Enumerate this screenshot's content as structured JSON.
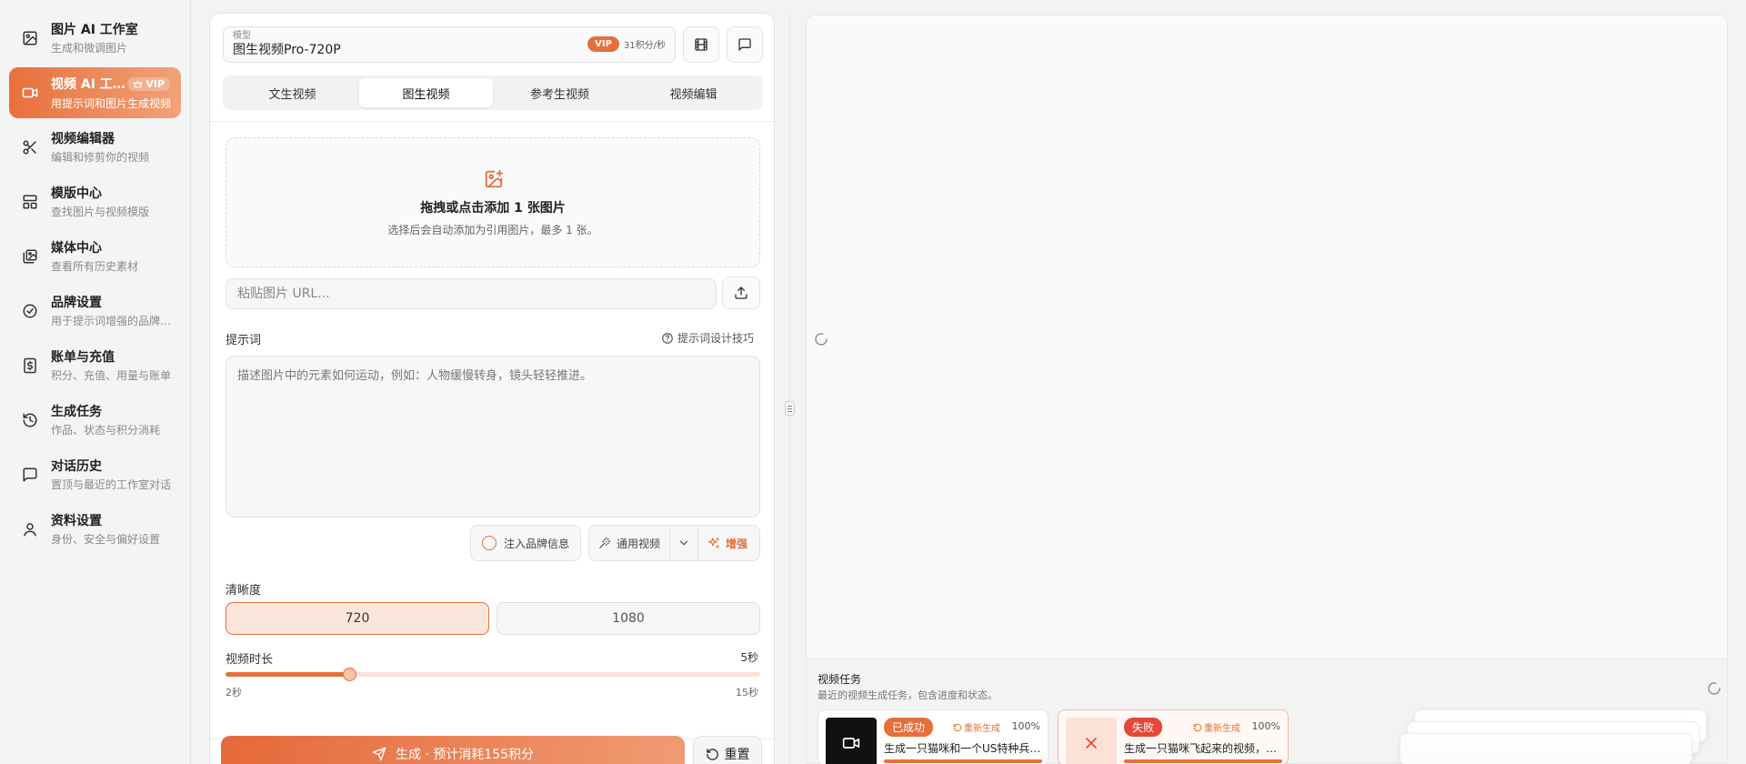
{
  "sidebar": {
    "items": [
      {
        "title": "图片 AI 工作室",
        "sub": "生成和微调图片",
        "icon": "image-icon"
      },
      {
        "title": "视频 AI 工作室",
        "sub": "用提示词和图片生成视频",
        "icon": "video-icon",
        "badge": "VIP"
      },
      {
        "title": "视频编辑器",
        "sub": "编辑和修剪你的视频",
        "icon": "scissors-icon"
      },
      {
        "title": "模版中心",
        "sub": "查找图片与视频模版",
        "icon": "layout-icon"
      },
      {
        "title": "媒体中心",
        "sub": "查看所有历史素材",
        "icon": "gallery-icon"
      },
      {
        "title": "品牌设置",
        "sub": "用于提示词增强的品牌信息",
        "icon": "badge-check-icon"
      },
      {
        "title": "账单与充值",
        "sub": "积分、充值、用量与账单",
        "icon": "billing-icon"
      },
      {
        "title": "生成任务",
        "sub": "作品、状态与积分消耗",
        "icon": "history-icon"
      },
      {
        "title": "对话历史",
        "sub": "置顶与最近的工作室对话",
        "icon": "chat-icon"
      },
      {
        "title": "资料设置",
        "sub": "身份、安全与偏好设置",
        "icon": "user-icon"
      }
    ]
  },
  "model": {
    "label": "模型",
    "value": "图生视频Pro-720P",
    "vip": "VIP",
    "rate": "31积分/秒"
  },
  "tabs": [
    {
      "label": "文生视频"
    },
    {
      "label": "图生视频"
    },
    {
      "label": "参考生视频"
    },
    {
      "label": "视频编辑"
    }
  ],
  "upload": {
    "title": "拖拽或点击添加 1 张图片",
    "sub": "选择后会自动添加为引用图片，最多 1 张。",
    "url_placeholder": "粘贴图片 URL..."
  },
  "prompt": {
    "label": "提示词",
    "tips": "提示词设计技巧",
    "placeholder": "描述图片中的元素如何运动，例如：人物缓慢转身，镜头轻轻推进。",
    "brand_toggle": "注入品牌信息",
    "style": "通用视频",
    "enhance": "增强"
  },
  "resolution": {
    "label": "清晰度",
    "options": [
      "720",
      "1080"
    ],
    "selected": "720"
  },
  "duration": {
    "label": "视频时长",
    "value_label": "5秒",
    "min_label": "2秒",
    "max_label": "15秒",
    "min": 2,
    "max": 15,
    "value": 5
  },
  "actions": {
    "generate": "生成 · 预计消耗155积分",
    "reset": "重置"
  },
  "tasks": {
    "title": "视频任务",
    "sub": "最近的视频生成任务，包含进度和状态。",
    "items": [
      {
        "status": "已成功",
        "retry": "重新生成",
        "percent": "100%",
        "progress": 100,
        "text": "生成一只猫咪和一个US特种兵的视频"
      },
      {
        "status": "失败",
        "retry": "重新生成",
        "percent": "100%",
        "progress": 100,
        "text": "生成一只猫咪飞起来的视频，背景是城市"
      }
    ]
  },
  "colors": {
    "accent": "#e5703b",
    "danger": "#e5483b"
  }
}
